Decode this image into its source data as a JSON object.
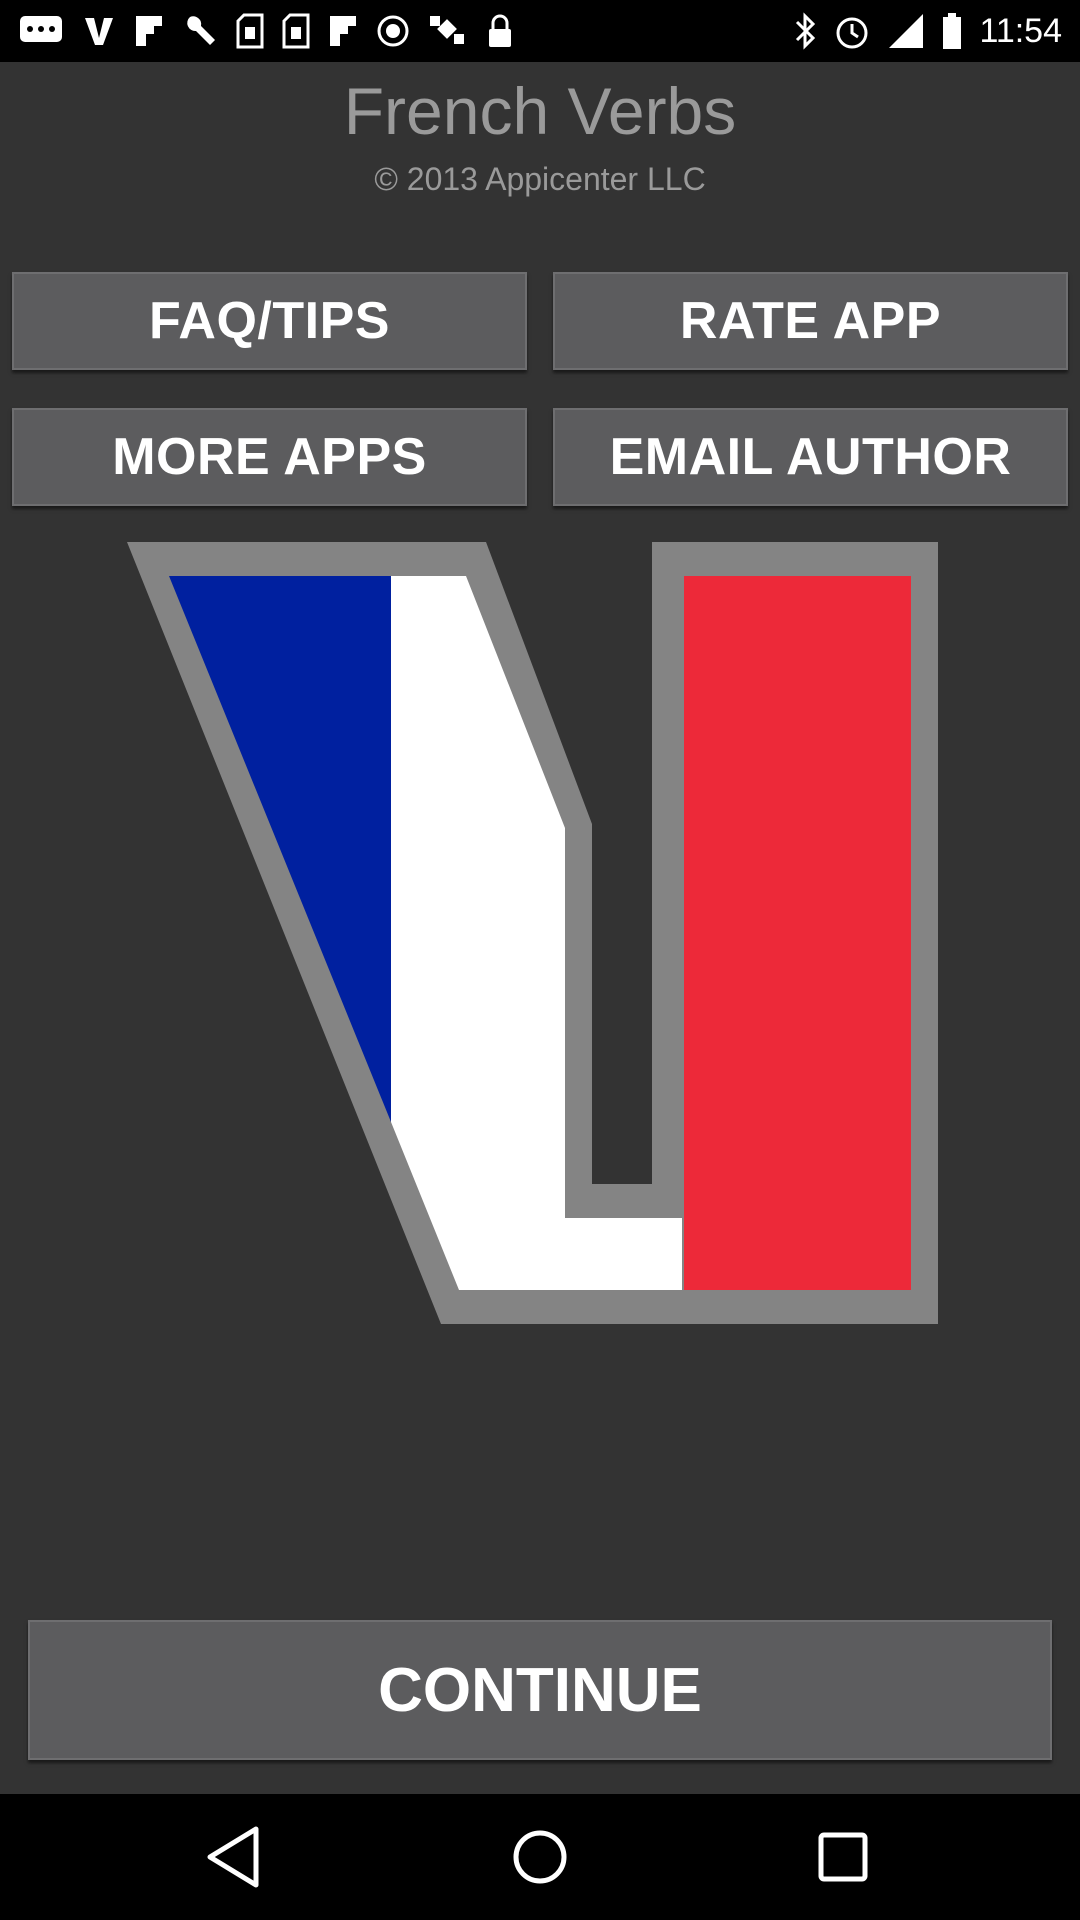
{
  "status_bar": {
    "time": "11:54",
    "left_icons": [
      "chat-icon",
      "vine-icon",
      "flipboard-icon",
      "wrench-icon",
      "sim-icon",
      "sim-icon",
      "flipboard-icon",
      "record-icon",
      "satellite-icon",
      "lock-icon"
    ],
    "right_icons": [
      "bluetooth-icon",
      "alarm-icon",
      "signal-icon",
      "battery-icon"
    ]
  },
  "app": {
    "title": "French Verbs",
    "copyright": "© 2013 Appicenter LLC"
  },
  "menu": {
    "faq_label": "FAQ/TIPS",
    "rate_label": "RATE APP",
    "more_label": "MORE APPS",
    "email_label": "EMAIL AUTHOR"
  },
  "logo": {
    "icon": "french-flag-v-logo",
    "colors": {
      "blue": "#00209f",
      "white": "#ffffff",
      "red": "#ed2939",
      "outline": "#848484"
    }
  },
  "continue_label": "CONTINUE",
  "nav_bar": {
    "back_icon": "back-triangle-icon",
    "home_icon": "home-circle-icon",
    "recents_icon": "recents-square-icon"
  }
}
